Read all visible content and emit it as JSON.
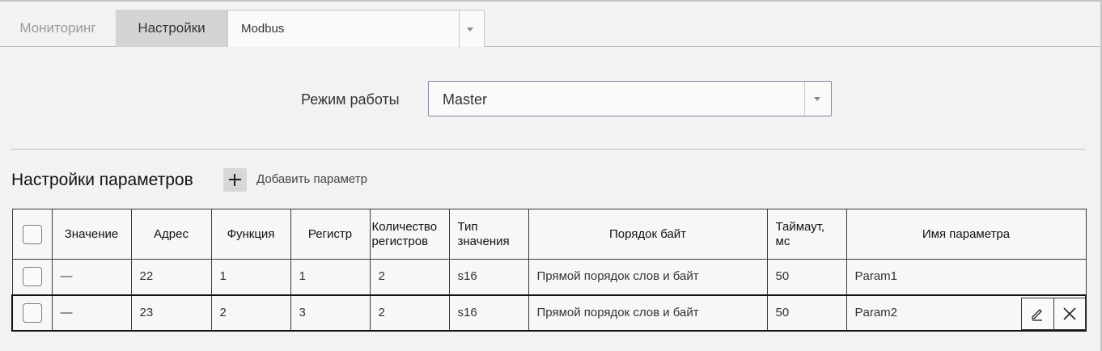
{
  "tabs": {
    "monitoring": "Мониторинг",
    "settings": "Настройки",
    "protocol_selected": "Modbus"
  },
  "mode": {
    "label": "Режим работы",
    "value": "Master"
  },
  "params": {
    "title": "Настройки параметров",
    "add_label": "Добавить параметр"
  },
  "table": {
    "headers": {
      "value": "Значение",
      "address": "Адрес",
      "function": "Функция",
      "register": "Регистр",
      "reg_count_1": "Количество",
      "reg_count_2": "регистров",
      "type_1": "Тип",
      "type_2": "значения",
      "byte_order": "Порядок байт",
      "timeout_1": "Таймаут,",
      "timeout_2": "мс",
      "name": "Имя параметра"
    },
    "rows": [
      {
        "value": "—",
        "address": "22",
        "function": "1",
        "register": "1",
        "reg_count": "2",
        "type": "s16",
        "byte_order": "Прямой порядок слов и байт",
        "timeout": "50",
        "name": "Param1"
      },
      {
        "value": "—",
        "address": "23",
        "function": "2",
        "register": "3",
        "reg_count": "2",
        "type": "s16",
        "byte_order": "Прямой порядок слов и байт",
        "timeout": "50",
        "name": "Param2"
      }
    ]
  },
  "icons": {
    "dropdown": "chevron-down-icon",
    "add": "plus-icon",
    "edit": "pencil-icon",
    "delete": "close-icon"
  }
}
